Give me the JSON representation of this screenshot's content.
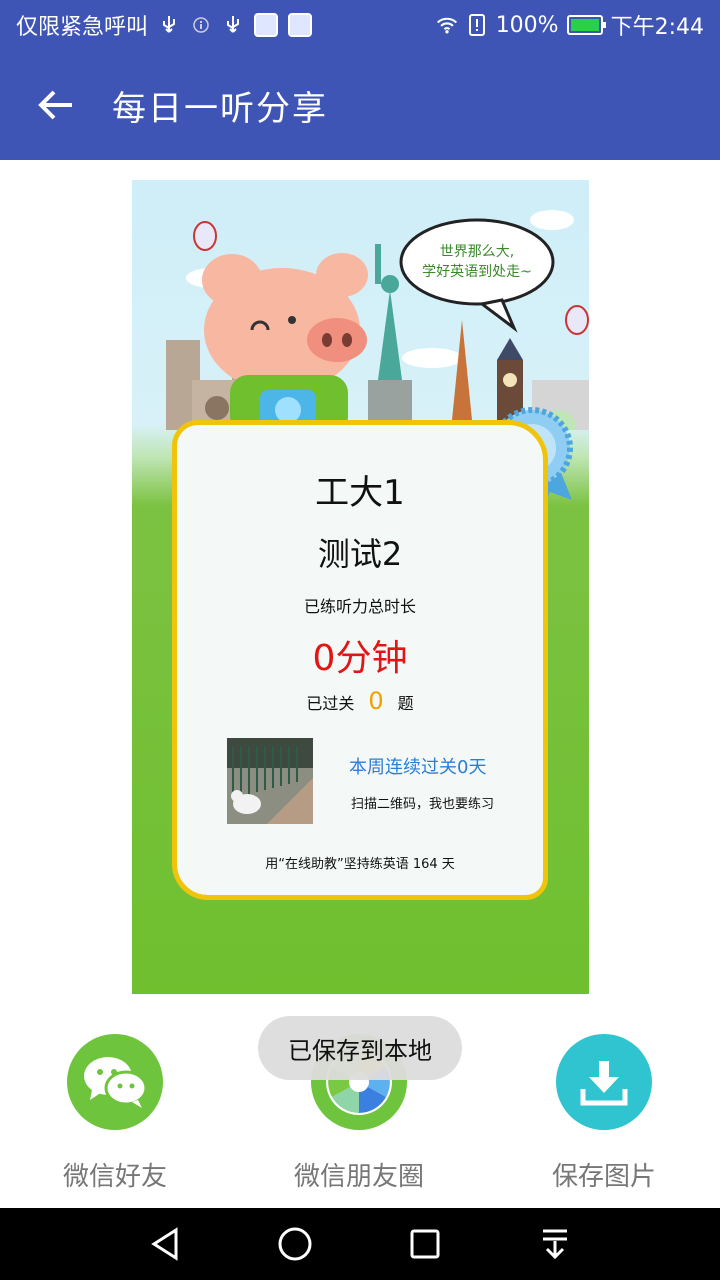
{
  "status_bar": {
    "left_text": "仅限紧急呼叫",
    "icons": [
      "usb-icon",
      "info-icon",
      "usb-icon",
      "app-badge-icon",
      "app-badge-icon"
    ],
    "battery": "100%",
    "time": "下午2:44"
  },
  "app_bar": {
    "title": "每日一听分享",
    "back_icon": "arrow-left-icon"
  },
  "poster": {
    "bubble_text": "世界那么大，学好英语到处走~",
    "name_line1": "工大1",
    "name_line2": "测试2",
    "duration_label": "已练听力总时长",
    "duration_value": "0分钟",
    "passed_prefix": "已过关",
    "passed_count": "0",
    "passed_suffix": "题",
    "streak_text": "本周连续过关0天",
    "scan_tip": "扫描二维码，我也要练习",
    "footer_tip": "用“在线助教”坚持练英语 164 天"
  },
  "share": {
    "items": [
      {
        "label": "微信好友",
        "icon": "wechat-icon",
        "color": "#6ec43c"
      },
      {
        "label": "微信朋友圈",
        "icon": "moments-icon",
        "color": "#6ec43c"
      },
      {
        "label": "保存图片",
        "icon": "download-icon",
        "color": "#2fc4cf"
      }
    ]
  },
  "toast": {
    "text": "已保存到本地"
  },
  "nav_bar": {
    "icons": [
      "back-triangle-icon",
      "home-circle-icon",
      "recents-square-icon",
      "notification-pull-icon"
    ]
  },
  "colors": {
    "app_bar": "#3f55b6",
    "duration_red": "#e01515",
    "passed_orange": "#f0a000",
    "streak_blue": "#2a7fd4",
    "card_border": "#f0c40b"
  }
}
